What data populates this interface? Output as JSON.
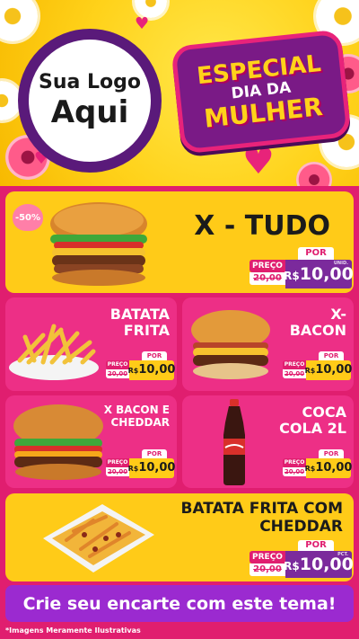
{
  "header": {
    "logo_line1": "Sua Logo",
    "logo_line2": "Aqui",
    "badge_line1": "ESPECIAL",
    "badge_line2": "DIA DA",
    "badge_line3": "MULHER"
  },
  "products": [
    {
      "name": "X - TUDO",
      "discount": "-50%",
      "preco_label": "PREÇO",
      "old_price": "20,00",
      "por_label": "POR",
      "currency": "R$",
      "new_price": "10,00",
      "unit": "UNID."
    },
    {
      "name_line1": "BATATA",
      "name_line2": "FRITA",
      "preco_label": "PREÇO",
      "old_price": "20,00",
      "por_label": "POR",
      "currency": "R$",
      "new_price": "10,00"
    },
    {
      "name_line1": "X-",
      "name_line2": "BACON",
      "preco_label": "PREÇO",
      "old_price": "20,00",
      "por_label": "POR",
      "currency": "R$",
      "new_price": "10,00"
    },
    {
      "name_line1": "X BACON E",
      "name_line2": "CHEDDAR",
      "preco_label": "PREÇO",
      "old_price": "20,00",
      "por_label": "POR",
      "currency": "R$",
      "new_price": "10,00"
    },
    {
      "name_line1": "COCA",
      "name_line2": "COLA 2L",
      "preco_label": "PREÇO",
      "old_price": "20,00",
      "por_label": "POR",
      "currency": "R$",
      "new_price": "10,00"
    },
    {
      "name_line1": "BATATA FRITA COM",
      "name_line2": "CHEDDAR",
      "preco_label": "PREÇO",
      "old_price": "20,00",
      "por_label": "POR",
      "currency": "R$",
      "new_price": "10,00",
      "unit": "PCT."
    }
  ],
  "footer": {
    "cta": "Crie seu encarte com este tema!",
    "disclaimer": "*Imagens Meramente Ilustrativas"
  },
  "colors": {
    "background_pink": "#e01e6f",
    "card_yellow": "#ffcb18",
    "card_pink": "#ed2f86",
    "price_purple": "#7b2a9c",
    "cta_purple": "#9b2ad0"
  }
}
